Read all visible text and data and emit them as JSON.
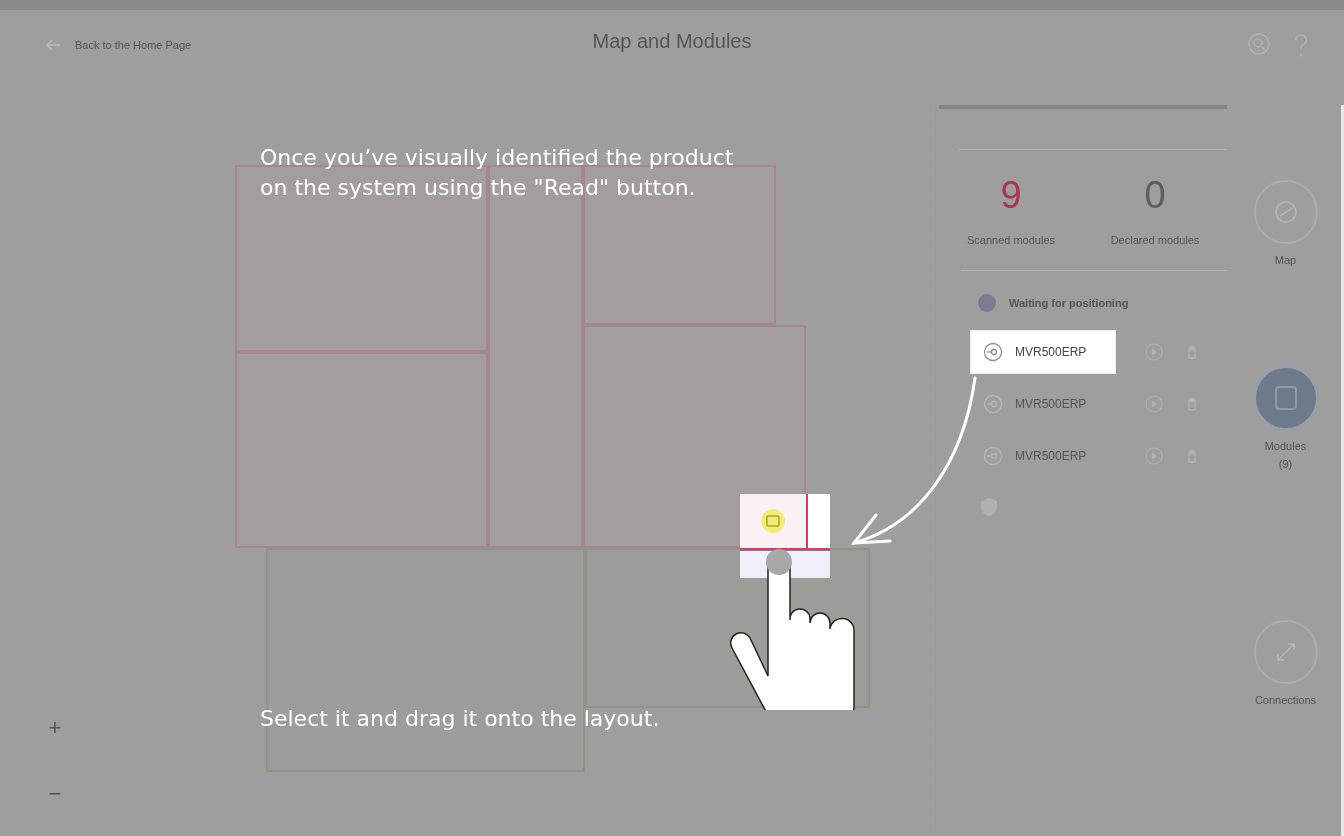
{
  "header": {
    "back_label": "Back to the Home Page",
    "title": "Map and Modules"
  },
  "summary": [
    {
      "value": "9",
      "label": "Scanned modules",
      "color": "#a8364f"
    },
    {
      "value": "0",
      "label": "Declared modules",
      "color": "#5e5e5e"
    }
  ],
  "waiting": {
    "title": "Waiting for positioning"
  },
  "modules": [
    {
      "name": "MVR500ERP",
      "highlighted": true
    },
    {
      "name": "MVR500ERP",
      "highlighted": false
    },
    {
      "name": "MVR500ERP",
      "highlighted": false
    }
  ],
  "rail": [
    {
      "label": "Map",
      "selected": false
    },
    {
      "label": "Modules",
      "count": "(9)",
      "selected": true
    },
    {
      "label": "Connections",
      "selected": false
    }
  ],
  "zoom": [
    "+",
    "−"
  ],
  "tutorial": {
    "steps": [
      "Once you’ve visually identified the product on the system using the \"Read\" button.",
      "Select it and drag it onto the layout."
    ]
  }
}
